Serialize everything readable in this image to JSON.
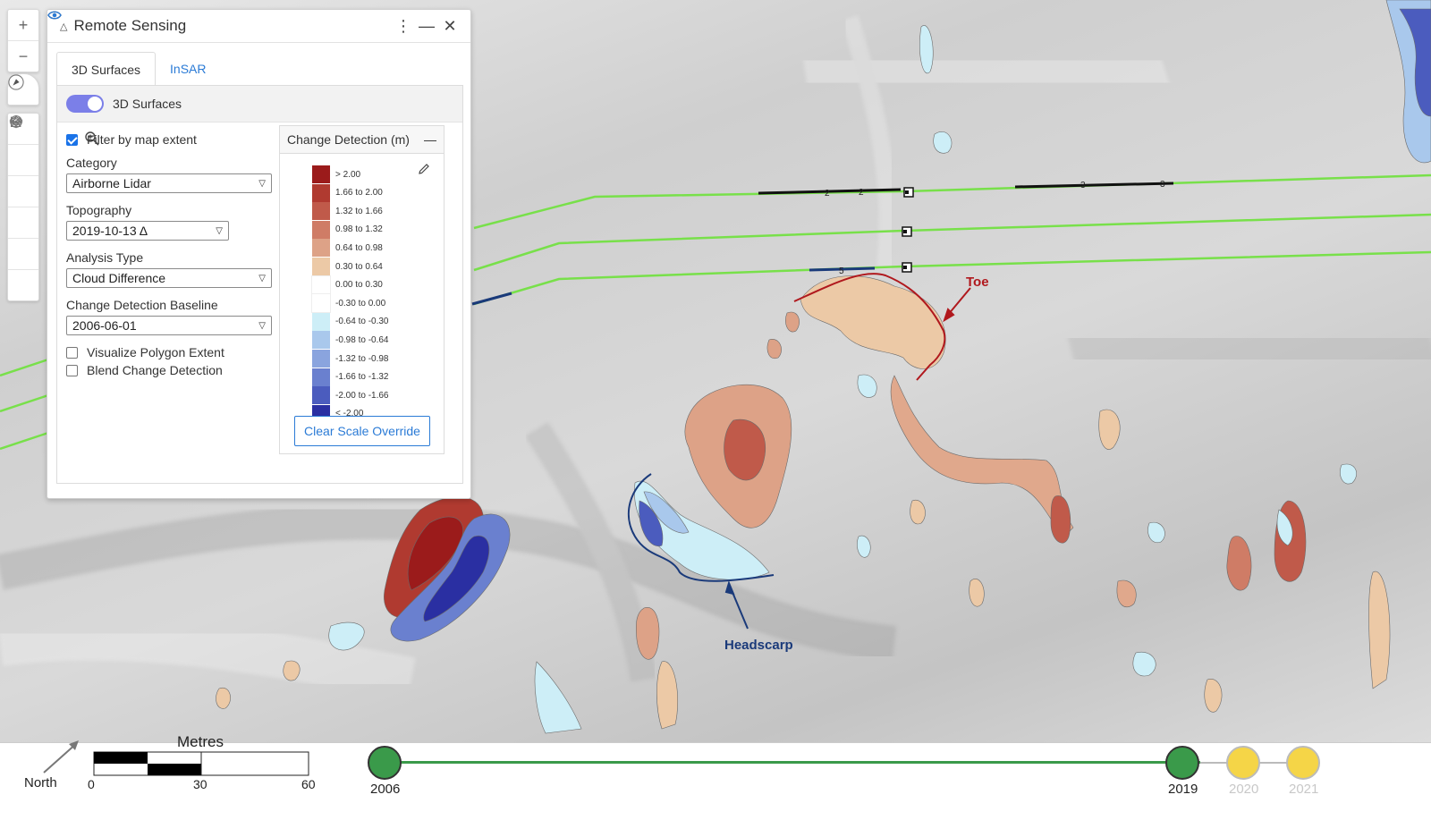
{
  "panel": {
    "title": "Remote Sensing",
    "tabs": [
      {
        "label": "3D Surfaces"
      },
      {
        "label": "InSAR"
      }
    ],
    "toggle_label": "3D Surfaces",
    "filter_label": "Filter by map extent",
    "category": {
      "label": "Category",
      "value": "Airborne Lidar"
    },
    "topography": {
      "label": "Topography",
      "value": "2019-10-13 Δ"
    },
    "analysis": {
      "label": "Analysis Type",
      "value": "Cloud Difference"
    },
    "baseline": {
      "label": "Change Detection Baseline",
      "value": "2006-06-01"
    },
    "visualize_label": "Visualize Polygon Extent",
    "blend_label": "Blend Change Detection",
    "toggle_on": true,
    "filter_checked": true,
    "visualize_checked": false,
    "blend_checked": false
  },
  "legend": {
    "title": "Change Detection (m)",
    "clear_label": "Clear Scale Override",
    "items": [
      {
        "label": "> 2.00",
        "color": "#9b1b1b"
      },
      {
        "label": "1.66 to 2.00",
        "color": "#b03a30"
      },
      {
        "label": "1.32 to 1.66",
        "color": "#c05a4a"
      },
      {
        "label": "0.98 to 1.32",
        "color": "#cf7c66"
      },
      {
        "label": "0.64 to 0.98",
        "color": "#dda287"
      },
      {
        "label": "0.30 to 0.64",
        "color": "#ecc9a6"
      },
      {
        "label": "0.00 to 0.30",
        "color": "#ffffff"
      },
      {
        "label": "-0.30 to 0.00",
        "color": "#ffffff"
      },
      {
        "label": "-0.64 to -0.30",
        "color": "#cdeef7"
      },
      {
        "label": "-0.98 to -0.64",
        "color": "#a9c8ec"
      },
      {
        "label": "-1.32 to -0.98",
        "color": "#8aa4de"
      },
      {
        "label": "-1.66 to -1.32",
        "color": "#6a80cf"
      },
      {
        "label": "-2.00 to -1.66",
        "color": "#4b5cbe"
      },
      {
        "label": "< -2.00",
        "color": "#2a2fa2"
      }
    ]
  },
  "map": {
    "annotations": {
      "toe": "Toe",
      "headscarp": "Headscarp"
    },
    "toe_color": "#b0181d",
    "headscarp_color": "#1a3a7a",
    "line_color": "#78e04a",
    "segment_labels": [
      "2",
      "2",
      "3",
      "3",
      "5"
    ]
  },
  "scale_bar": {
    "title": "Metres",
    "ticks": [
      "0",
      "30",
      "60"
    ],
    "north_label": "North"
  },
  "timeline": {
    "years": [
      {
        "label": "2006",
        "state": "active"
      },
      {
        "label": "2019",
        "state": "active"
      },
      {
        "label": "2020",
        "state": "inactive"
      },
      {
        "label": "2021",
        "state": "inactive"
      }
    ],
    "active_color": "#3a9a4a",
    "inactive_color": "#f5d547"
  }
}
